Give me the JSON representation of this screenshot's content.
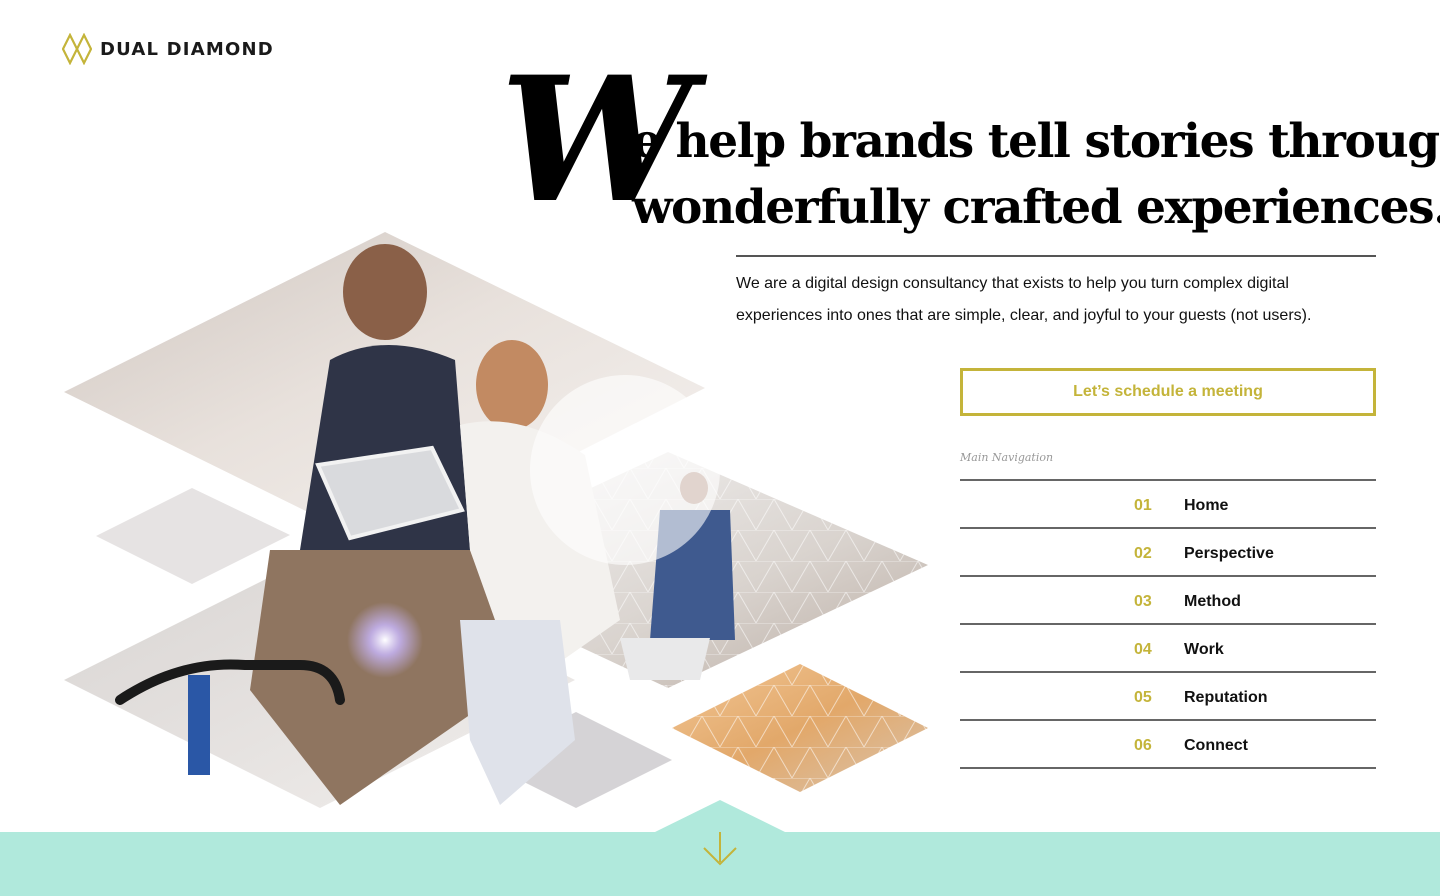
{
  "brand": {
    "name": "DUAL DIAMOND",
    "logo_icon": "dual-diamond-icon",
    "accent": "#c4b43a",
    "band_color": "#b0e9dc"
  },
  "hero": {
    "drop_cap": "W",
    "line1": "e help brands tell stories through",
    "line2": "wonderfully crafted experiences.",
    "intro": "We are a digital design consultancy that exists to help you turn complex digital experiences into ones that are simple, clear, and joyful to your guests (not users)."
  },
  "cta": {
    "label": "Let’s schedule a meeting"
  },
  "nav": {
    "caption": "Main Navigation",
    "items": [
      {
        "num": "01",
        "label": "Home"
      },
      {
        "num": "02",
        "label": "Perspective"
      },
      {
        "num": "03",
        "label": "Method"
      },
      {
        "num": "04",
        "label": "Work"
      },
      {
        "num": "05",
        "label": "Reputation"
      },
      {
        "num": "06",
        "label": "Connect"
      }
    ]
  },
  "scroll": {
    "icon": "arrow-down-icon"
  }
}
